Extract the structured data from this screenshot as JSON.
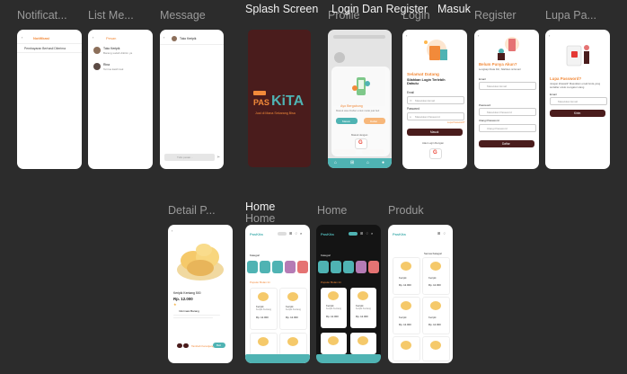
{
  "frame_labels": {
    "notifikasi": "Notificat...",
    "list_message": "List Me...",
    "message": "Message",
    "splash": "Splash Screen",
    "profile": "Profile",
    "login_register": "Login Dan Register",
    "login": "Login",
    "register": "Register",
    "lupa_password": "Lupa Pa...",
    "detail_produk": "Detail P...",
    "home_a_title": "Home",
    "home_a_sub": "Home",
    "home_b": "Home",
    "produk": "Produk"
  },
  "splash": {
    "brand": "PasKita",
    "tagline": "Jual di Mana Sekarang Bisa"
  },
  "notifikasi": {
    "title": "Notifikasi",
    "item": "Pembayaran Berhasil Diterima"
  },
  "list_message": {
    "title": "Pesan",
    "items": [
      {
        "name": "Toko Keripik",
        "text": "Barang sudah dikirim ya"
      },
      {
        "name": "Rina",
        "text": "Terima kasih kak"
      }
    ]
  },
  "message": {
    "name": "Toko Keripik",
    "placeholder": "Tulis pesan..."
  },
  "profile": {
    "buttons": [
      "Masuk",
      "Daftar"
    ]
  },
  "login_register": {
    "headline": "Ayo Bergabung",
    "subtext": "Masuk atau Daftar untuk mulai jual beli",
    "login_btn": "Masuk",
    "register_btn": "Daftar",
    "alt_login": "Masuk dengan"
  },
  "login": {
    "welcome": "Selamat Datang",
    "heading": "Silahkan Login Terlebih Dahulu",
    "email_label": "Email",
    "email_placeholder": "Masukkan Email",
    "password_label": "Password",
    "password_placeholder": "Masukkan Password",
    "forgot": "Lupa Password?",
    "button": "Masuk",
    "alt": "Atau Login Dengan"
  },
  "register": {
    "title": "Belum Punya Akun?",
    "subtitle": "Lengkapi Data Diri, Silahkan isi Email",
    "email_label": "Email",
    "email_placeholder": "Masukkan Email",
    "password_label": "Password",
    "password_placeholder": "Masukkan Password",
    "confirm_label": "Ulangi Password",
    "confirm_placeholder": "Ulangi Password",
    "button": "Daftar"
  },
  "lupa_password": {
    "title": "Lupa Password?",
    "subtitle": "Jangan khawatir! Masukkan email Anda yang terdaftar untuk mengatur ulang",
    "email_label": "Email",
    "email_placeholder": "Masukkan Email",
    "button": "Kirim"
  },
  "detail": {
    "name": "Keripik Kentang 500",
    "price": "Rp. 12.000",
    "store": "Informasi Barang",
    "buy": "Beli",
    "cart": "Tambah Keranjang"
  },
  "home": {
    "brand": "PasKita",
    "kategori": "Kategori",
    "categories": [
      "Makanan",
      "Minuman",
      "Pakaian",
      "Kosmetik",
      "Lainnya"
    ],
    "section": "Populer Bulan Ini",
    "product_name": "Keripik",
    "product_sub": "Keripik Kentang",
    "product_price": "Rp. 12.000"
  },
  "produk": {
    "filter": "Semua Kategori",
    "product_name": "Keripik",
    "product_price": "Rp. 12.000"
  },
  "colors": {
    "canvas": "#2c2c2c",
    "maroon": "#4a1c1c",
    "teal": "#4fb3b3",
    "orange": "#f28a3a",
    "pink": "#e57373",
    "dark": "#141414"
  }
}
